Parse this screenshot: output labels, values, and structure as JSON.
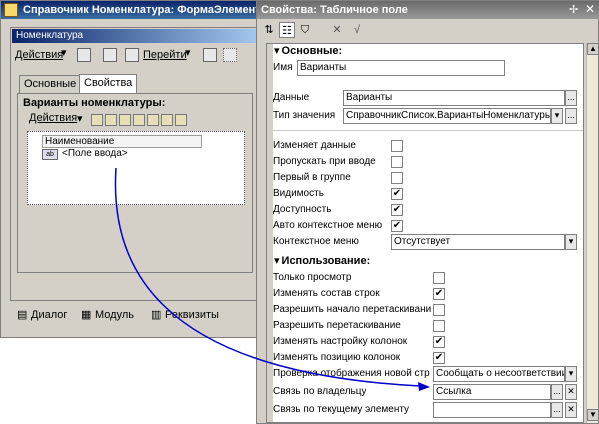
{
  "designer": {
    "title": "Справочник Номенклатура: ФормаЭлемента",
    "form_title": "Номенклатура",
    "toolbar": {
      "actions": "Действия",
      "go_to": "Перейти"
    },
    "tabs": [
      "Основные",
      "Свойства"
    ],
    "grid_caption": "Варианты номенклатуры:",
    "grid_actions": "Действия",
    "grid_header": "Наименование",
    "grid_cell": "<Поле ввода>",
    "bottom_tabs": [
      "Диалог",
      "Модуль",
      "Реквизиты"
    ]
  },
  "props": {
    "title": "Свойства: Табличное поле",
    "sections": {
      "basic": "Основные:",
      "usage": "Использование:"
    },
    "rows": {
      "name": {
        "label": "Имя",
        "value": "Варианты"
      },
      "data": {
        "label": "Данные",
        "value": "Варианты"
      },
      "value_type": {
        "label": "Тип значения",
        "value": "СправочникСписок.ВариантыНоменклатуры"
      },
      "change_data": {
        "label": "Изменяет данные"
      },
      "skip_input": {
        "label": "Пропускать при вводе"
      },
      "first_in_group": {
        "label": "Первый в группе"
      },
      "visibility": {
        "label": "Видимость"
      },
      "accessibility": {
        "label": "Доступность"
      },
      "auto_context_menu": {
        "label": "Авто контекстное меню"
      },
      "context_menu": {
        "label": "Контекстное меню",
        "value": "Отсутствует"
      },
      "view_only": {
        "label": "Только просмотр"
      },
      "change_row_set": {
        "label": "Изменять состав строк"
      },
      "allow_drag_start": {
        "label": "Разрешить начало перетаскивания"
      },
      "allow_drag": {
        "label": "Разрешить перетаскивание"
      },
      "change_column_setup": {
        "label": "Изменять настройку колонок"
      },
      "change_column_position": {
        "label": "Изменять позицию колонок"
      },
      "check_new_row_display": {
        "label": "Проверка отображения новой стр",
        "value": "Сообщать о несоответствии"
      },
      "link_by_owner": {
        "label": "Связь по владельцу",
        "value": "Ссылка"
      },
      "link_by_current_element": {
        "label": "Связь по текущему элементу"
      }
    },
    "checkboxes": {
      "change_data": false,
      "skip_input": false,
      "first_in_group": false,
      "visibility": true,
      "accessibility": true,
      "auto_context_menu": true,
      "view_only": false,
      "change_row_set": true,
      "allow_drag_start": false,
      "allow_drag": false,
      "change_column_setup": true,
      "change_column_position": true
    },
    "check_glyph": "✔",
    "icons": {
      "sort": "sort-icon",
      "categories": "categories-icon",
      "filter": "filter-icon",
      "clear": "clear-icon",
      "ok": "ok-icon"
    },
    "arrow_color": "#0000cc"
  }
}
